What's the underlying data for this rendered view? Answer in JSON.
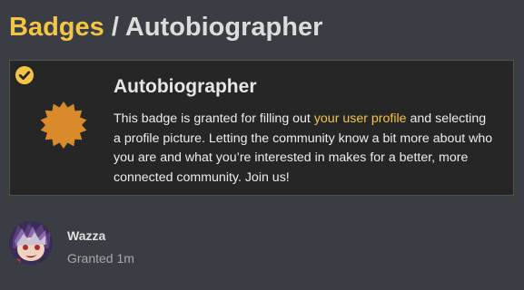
{
  "header": {
    "breadcrumb_parent": "Badges",
    "separator": "/",
    "title": "Autobiographer"
  },
  "badge": {
    "name": "Autobiographer",
    "description_before": "This badge is granted for filling out ",
    "description_link": "your user profile",
    "description_after": " and selecting a profile picture. Letting the community know a bit more about who you are and what you’re interested in makes for a better, more connected community. Join us!",
    "granted": true,
    "icon": "badge-starburst-icon",
    "icon_color": "#d98a2b",
    "accent_color": "#f3c542"
  },
  "grant": {
    "username": "Wazza",
    "granted_text": "Granted 1m"
  }
}
